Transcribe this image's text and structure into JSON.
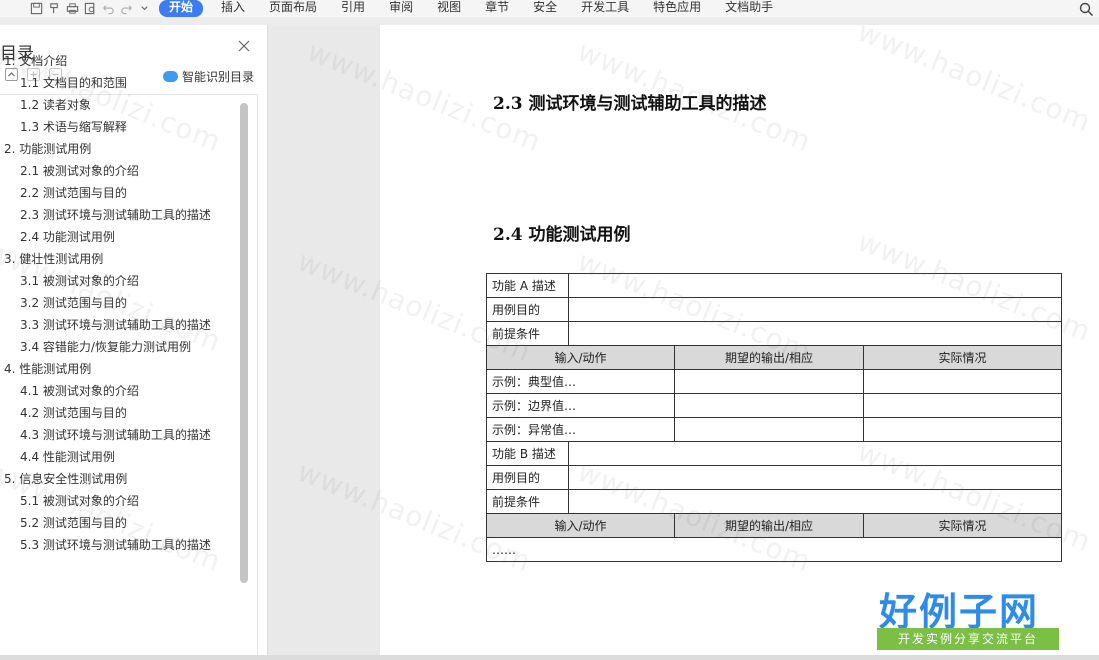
{
  "menubar": {
    "items": [
      "开始",
      "插入",
      "页面布局",
      "引用",
      "审阅",
      "视图",
      "章节",
      "安全",
      "开发工具",
      "特色应用",
      "文档助手"
    ],
    "active": "开始",
    "quick_icons": [
      "save-icon",
      "format-painter-icon",
      "print-icon",
      "print-preview-icon",
      "undo-icon",
      "redo-icon",
      "more-icon"
    ],
    "search_icon": "search-icon"
  },
  "toc": {
    "title": "目录",
    "smart_label": "智能识别目录",
    "items": [
      {
        "text": "1.  文档介绍",
        "level": 1
      },
      {
        "text": "1.1  文档目的和范围",
        "level": 2
      },
      {
        "text": "1.2  读者对象",
        "level": 2
      },
      {
        "text": "1.3  术语与缩写解释",
        "level": 2
      },
      {
        "text": "2.  功能测试用例",
        "level": 1
      },
      {
        "text": "2.1  被测试对象的介绍",
        "level": 2
      },
      {
        "text": "2.2  测试范围与目的",
        "level": 2
      },
      {
        "text": "2.3  测试环境与测试辅助工具的描述",
        "level": 2
      },
      {
        "text": "2.4  功能测试用例",
        "level": 2
      },
      {
        "text": "3.  健壮性测试用例",
        "level": 1
      },
      {
        "text": "3.1  被测试对象的介绍",
        "level": 2
      },
      {
        "text": "3.2  测试范围与目的",
        "level": 2
      },
      {
        "text": "3.3  测试环境与测试辅助工具的描述",
        "level": 2
      },
      {
        "text": "3.4  容错能力/恢复能力测试用例",
        "level": 2
      },
      {
        "text": "4.  性能测试用例",
        "level": 1
      },
      {
        "text": "4.1  被测试对象的介绍",
        "level": 2
      },
      {
        "text": "4.2  测试范围与目的",
        "level": 2
      },
      {
        "text": "4.3  测试环境与测试辅助工具的描述",
        "level": 2
      },
      {
        "text": "4.4  性能测试用例",
        "level": 2
      },
      {
        "text": "5.  信息安全性测试用例",
        "level": 1
      },
      {
        "text": "5.1  被测试对象的介绍",
        "level": 2
      },
      {
        "text": "5.2  测试范围与目的",
        "level": 2
      },
      {
        "text": "5.3  测试环境与测试辅助工具的描述",
        "level": 2
      }
    ]
  },
  "document": {
    "heading_23": "2.3  测试环境与测试辅助工具的描述",
    "heading_24": "2.4  功能测试用例",
    "table": {
      "func_a": "功能 A 描述",
      "purpose": "用例目的",
      "precondition": "前提条件",
      "col_input": "输入/动作",
      "col_expected": "期望的输出/相应",
      "col_actual": "实际情况",
      "ex_typical": "示例：典型值…",
      "ex_boundary": "示例：边界值…",
      "ex_abnormal": "示例：异常值…",
      "func_b": "功能 B 描述",
      "ellipsis": "……"
    }
  },
  "watermark": "www.haolizi.com",
  "logo": {
    "main": "好例子网",
    "sub": "开发实例分享交流平台"
  },
  "colors": {
    "accent": "#3c7cf0",
    "header_fill": "#d9d9d9",
    "logo_blue": "#2f8ce6",
    "logo_green": "#7bbf44"
  }
}
